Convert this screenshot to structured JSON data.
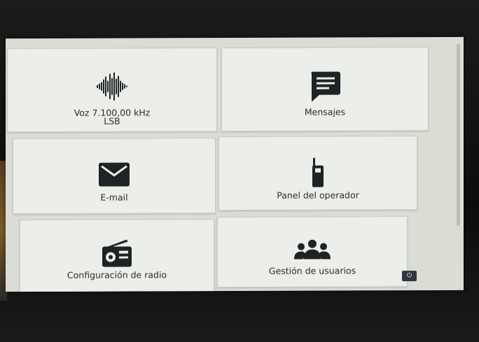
{
  "tiles": {
    "voice": {
      "line1": "Voz 7.100,00 kHz",
      "line2": "LSB",
      "icon": "audio-waveform-icon"
    },
    "messages": {
      "label": "Mensajes",
      "icon": "message-bubble-icon"
    },
    "email": {
      "label": "E-mail",
      "icon": "envelope-icon"
    },
    "operator_panel": {
      "label": "Panel del operador",
      "icon": "handheld-radio-icon"
    },
    "radio_config": {
      "label": "Configuración de radio",
      "icon": "radio-icon"
    },
    "user_management": {
      "label": "Gestión de usuarios",
      "icon": "users-group-icon"
    }
  },
  "power": {
    "icon": "power-icon",
    "glyph": "⏻"
  },
  "colors": {
    "screen_bg": "#d9ddd4",
    "tile_bg": "#eceee9",
    "icon": "#1f2326",
    "power_btn": "#2f3640"
  }
}
